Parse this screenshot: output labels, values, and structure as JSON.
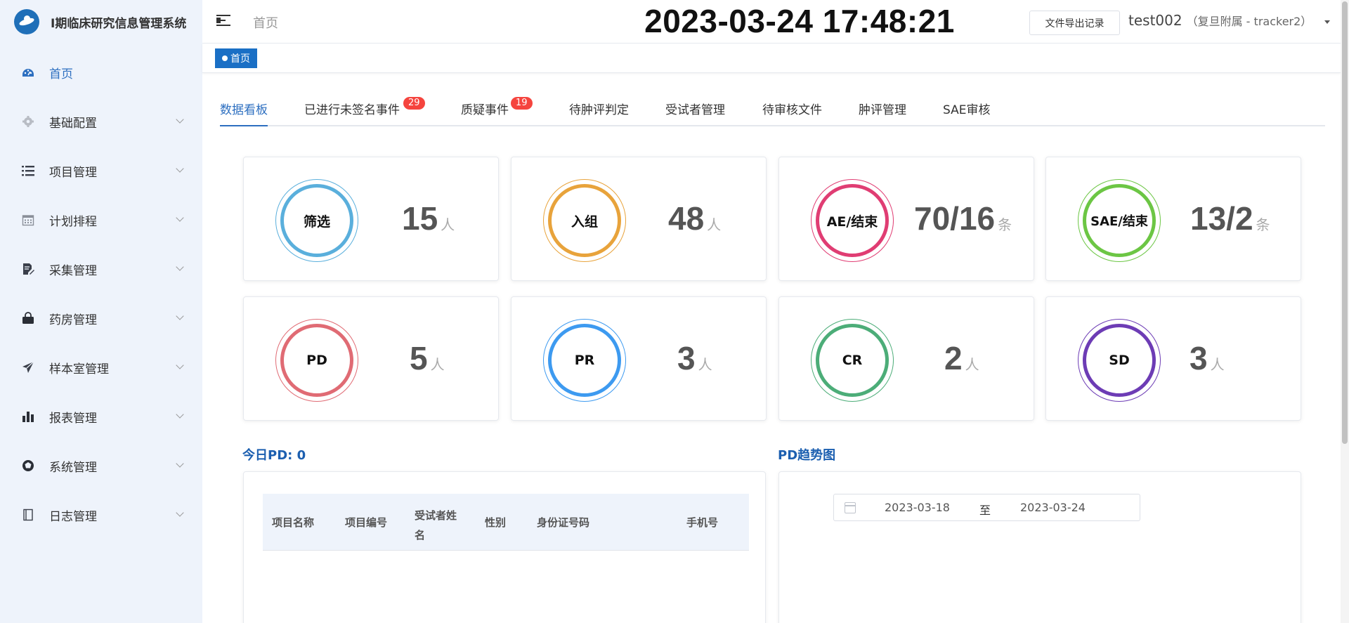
{
  "app": {
    "title": "I期临床研究信息管理系统"
  },
  "sidebar": {
    "items": [
      {
        "label": "首页",
        "icon": "dashboard-icon",
        "active": true
      },
      {
        "label": "基础配置",
        "icon": "gear-icon"
      },
      {
        "label": "项目管理",
        "icon": "list-icon"
      },
      {
        "label": "计划排程",
        "icon": "calendar-icon"
      },
      {
        "label": "采集管理",
        "icon": "edit-document-icon"
      },
      {
        "label": "药房管理",
        "icon": "lock-bag-icon"
      },
      {
        "label": "样本室管理",
        "icon": "paper-plane-icon"
      },
      {
        "label": "报表管理",
        "icon": "bar-chart-icon"
      },
      {
        "label": "系统管理",
        "icon": "aperture-icon"
      },
      {
        "label": "日志管理",
        "icon": "book-icon"
      }
    ]
  },
  "header": {
    "breadcrumb": "首页",
    "clock": "2023-03-24 17:48:21",
    "export_button": "文件导出记录",
    "user_name": "test002",
    "user_org": "（复旦附属 - tracker2）"
  },
  "tagsbar": {
    "active_tag": "首页"
  },
  "tabs": [
    {
      "label": "数据看板",
      "active": true
    },
    {
      "label": "已进行未签名事件",
      "badge": "29"
    },
    {
      "label": "质疑事件",
      "badge": "19"
    },
    {
      "label": "待肿评判定"
    },
    {
      "label": "受试者管理"
    },
    {
      "label": "待审核文件"
    },
    {
      "label": "肿评管理"
    },
    {
      "label": "SAE审核"
    }
  ],
  "stats": [
    {
      "label": "筛选",
      "value": "15",
      "unit": "人",
      "color": "#5aafdc"
    },
    {
      "label": "入组",
      "value": "48",
      "unit": "人",
      "color": "#e8a33b"
    },
    {
      "label": "AE/结束",
      "value": "70/16",
      "unit": "条",
      "color": "#e03d73"
    },
    {
      "label": "SAE/结束",
      "value": "13/2",
      "unit": "条",
      "color": "#6cc644"
    },
    {
      "label": "PD",
      "value": "5",
      "unit": "人",
      "color": "#e06b74"
    },
    {
      "label": "PR",
      "value": "3",
      "unit": "人",
      "color": "#3d9af0"
    },
    {
      "label": "CR",
      "value": "2",
      "unit": "人",
      "color": "#4cad78"
    },
    {
      "label": "SD",
      "value": "3",
      "unit": "人",
      "color": "#6d3cb5"
    }
  ],
  "today_pd": {
    "title": "今日PD: 0",
    "columns": [
      "项目名称",
      "项目编号",
      "受试者姓名",
      "性别",
      "身份证号码",
      "手机号"
    ]
  },
  "pd_trend": {
    "title": "PD趋势图",
    "date_start": "2023-03-18",
    "date_sep": "至",
    "date_end": "2023-03-24"
  }
}
